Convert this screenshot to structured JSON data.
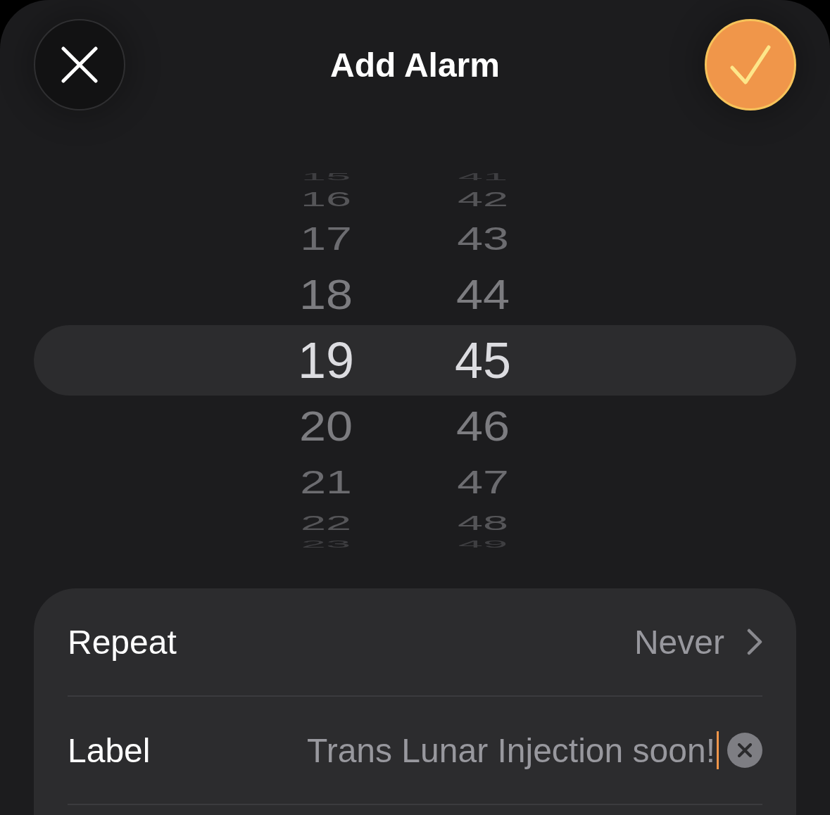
{
  "header": {
    "title": "Add Alarm"
  },
  "picker": {
    "hours": [
      {
        "value": "15",
        "selected": false
      },
      {
        "value": "16",
        "selected": false
      },
      {
        "value": "17",
        "selected": false
      },
      {
        "value": "18",
        "selected": false
      },
      {
        "value": "19",
        "selected": true
      },
      {
        "value": "20",
        "selected": false
      },
      {
        "value": "21",
        "selected": false
      },
      {
        "value": "22",
        "selected": false
      },
      {
        "value": "23",
        "selected": false
      }
    ],
    "minutes": [
      {
        "value": "41",
        "selected": false
      },
      {
        "value": "42",
        "selected": false
      },
      {
        "value": "43",
        "selected": false
      },
      {
        "value": "44",
        "selected": false
      },
      {
        "value": "45",
        "selected": true
      },
      {
        "value": "46",
        "selected": false
      },
      {
        "value": "47",
        "selected": false
      },
      {
        "value": "48",
        "selected": false
      },
      {
        "value": "49",
        "selected": false
      }
    ]
  },
  "settings": {
    "rows": [
      {
        "kind": "disclosure",
        "title": "Repeat",
        "value": "Never"
      },
      {
        "kind": "text_field",
        "title": "Label",
        "value": "Trans Lunar Injection soon!",
        "focused": true
      }
    ]
  }
}
